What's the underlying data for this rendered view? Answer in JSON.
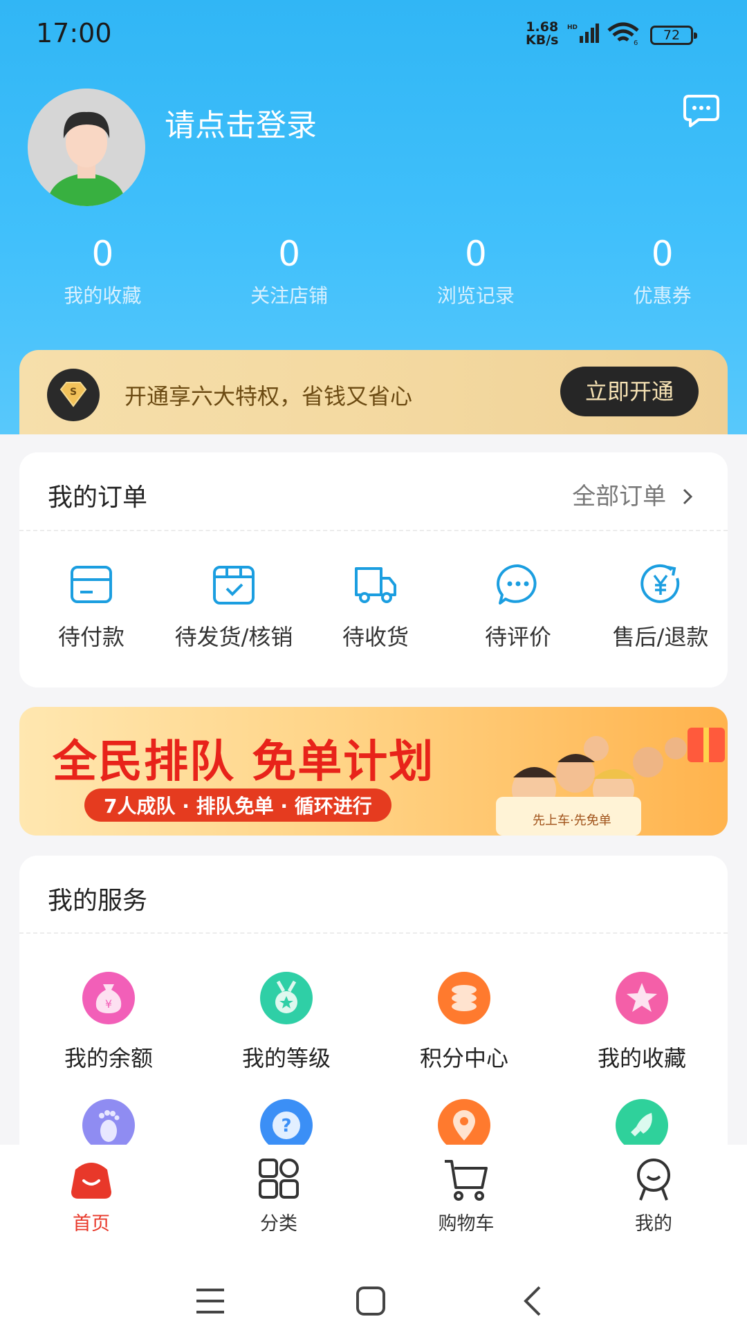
{
  "status": {
    "time": "17:00",
    "speed_top": "1.68",
    "speed_bottom": "KB/s",
    "hd": "HD",
    "battery": "72"
  },
  "profile": {
    "login_text": "请点击登录"
  },
  "stats": [
    {
      "value": "0",
      "label": "我的收藏"
    },
    {
      "value": "0",
      "label": "关注店铺"
    },
    {
      "value": "0",
      "label": "浏览记录"
    },
    {
      "value": "0",
      "label": "优惠券"
    }
  ],
  "vip": {
    "text": "开通享六大特权，省钱又省心",
    "button": "立即开通",
    "badge_letter": "S"
  },
  "orders": {
    "title": "我的订单",
    "all_label": "全部订单",
    "items": [
      {
        "label": "待付款",
        "icon": "card-icon"
      },
      {
        "label": "待发货/核销",
        "icon": "box-check-icon"
      },
      {
        "label": "待收货",
        "icon": "truck-icon"
      },
      {
        "label": "待评价",
        "icon": "chat-bubble-icon"
      },
      {
        "label": "售后/退款",
        "icon": "yen-refund-icon"
      }
    ]
  },
  "banner": {
    "title": "全民排队 免单计划",
    "subtitle": "7人成队 · 排队免单 · 循环进行",
    "ticket": "先上车·先免单"
  },
  "services": {
    "title": "我的服务",
    "items": [
      {
        "label": "我的余额",
        "icon": "money-bag-icon",
        "color": "#f06bc0"
      },
      {
        "label": "我的等级",
        "icon": "medal-icon",
        "color": "#2fcfa6"
      },
      {
        "label": "积分中心",
        "icon": "coins-icon",
        "color": "#ff7a2e"
      },
      {
        "label": "我的收藏",
        "icon": "star-icon",
        "color": "#f45fa8"
      },
      {
        "label": "",
        "icon": "footprint-icon",
        "color": "#8f8cf2"
      },
      {
        "label": "",
        "icon": "help-icon",
        "color": "#3b8ff6"
      },
      {
        "label": "",
        "icon": "location-icon",
        "color": "#ff7a2e"
      },
      {
        "label": "",
        "icon": "rocket-icon",
        "color": "#2fd19b"
      }
    ]
  },
  "tabbar": {
    "active_color": "#e8382a",
    "items": [
      {
        "label": "首页",
        "icon": "home-bag-icon"
      },
      {
        "label": "分类",
        "icon": "grid-icon"
      },
      {
        "label": "购物车",
        "icon": "cart-icon"
      },
      {
        "label": "我的",
        "icon": "profile-icon"
      }
    ]
  }
}
